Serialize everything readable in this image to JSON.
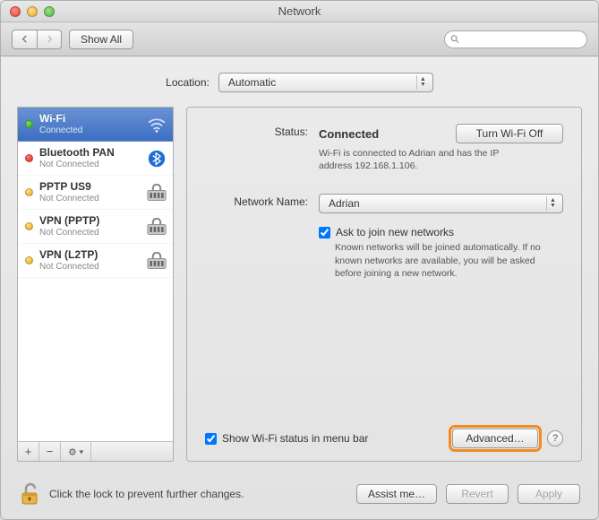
{
  "window": {
    "title": "Network"
  },
  "toolbar": {
    "show_all": "Show All",
    "search_placeholder": ""
  },
  "location": {
    "label": "Location:",
    "value": "Automatic"
  },
  "services": [
    {
      "name": "Wi-Fi",
      "status": "Connected",
      "dot": "green",
      "icon": "wifi",
      "selected": true
    },
    {
      "name": "Bluetooth PAN",
      "status": "Not Connected",
      "dot": "red",
      "icon": "bluetooth",
      "selected": false
    },
    {
      "name": "PPTP US9",
      "status": "Not Connected",
      "dot": "yellow",
      "icon": "vpn",
      "selected": false
    },
    {
      "name": "VPN (PPTP)",
      "status": "Not Connected",
      "dot": "yellow",
      "icon": "vpn",
      "selected": false
    },
    {
      "name": "VPN (L2TP)",
      "status": "Not Connected",
      "dot": "yellow",
      "icon": "vpn",
      "selected": false
    }
  ],
  "sidebar_buttons": {
    "add": "+",
    "remove": "−",
    "action": "✻▾"
  },
  "detail": {
    "status_label": "Status:",
    "status_value": "Connected",
    "status_desc": "Wi-Fi is connected to Adrian and has the IP address 192.168.1.106.",
    "wifi_off_btn": "Turn Wi-Fi Off",
    "network_name_label": "Network Name:",
    "network_name_value": "Adrian",
    "ask_join_label": "Ask to join new networks",
    "ask_join_desc": "Known networks will be joined automatically. If no known networks are available, you will be asked before joining a new network.",
    "show_menubar_label": "Show Wi-Fi status in menu bar",
    "advanced_btn": "Advanced…"
  },
  "footer": {
    "lock_text": "Click the lock to prevent further changes.",
    "assist_btn": "Assist me…",
    "revert_btn": "Revert",
    "apply_btn": "Apply"
  }
}
